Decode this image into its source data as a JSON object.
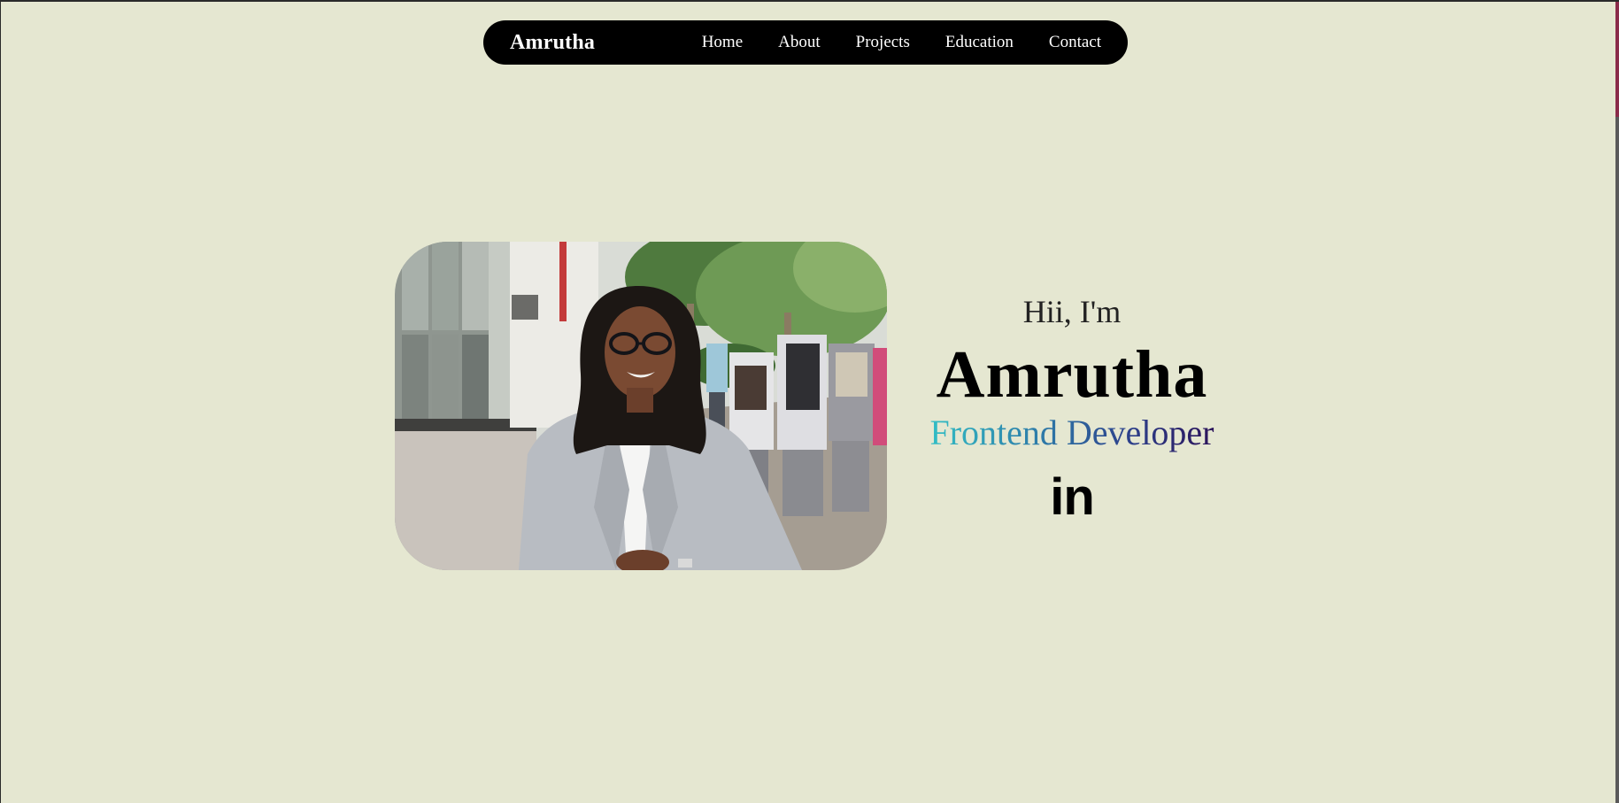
{
  "navbar": {
    "brand": "Amrutha",
    "links": [
      "Home",
      "About",
      "Projects",
      "Education",
      "Contact"
    ]
  },
  "hero": {
    "greeting": "Hii, I'm",
    "name": "Amrutha",
    "role": "Frontend Developer",
    "social": {
      "linkedin_label": "in",
      "icon": "linkedin-icon"
    },
    "photo": {
      "description_icon": "profile-photo"
    }
  },
  "colors": {
    "background": "#e5e7d1",
    "navbar": "#000000",
    "role_gradient_start": "#33c3c7",
    "role_gradient_end": "#2b0f55"
  }
}
